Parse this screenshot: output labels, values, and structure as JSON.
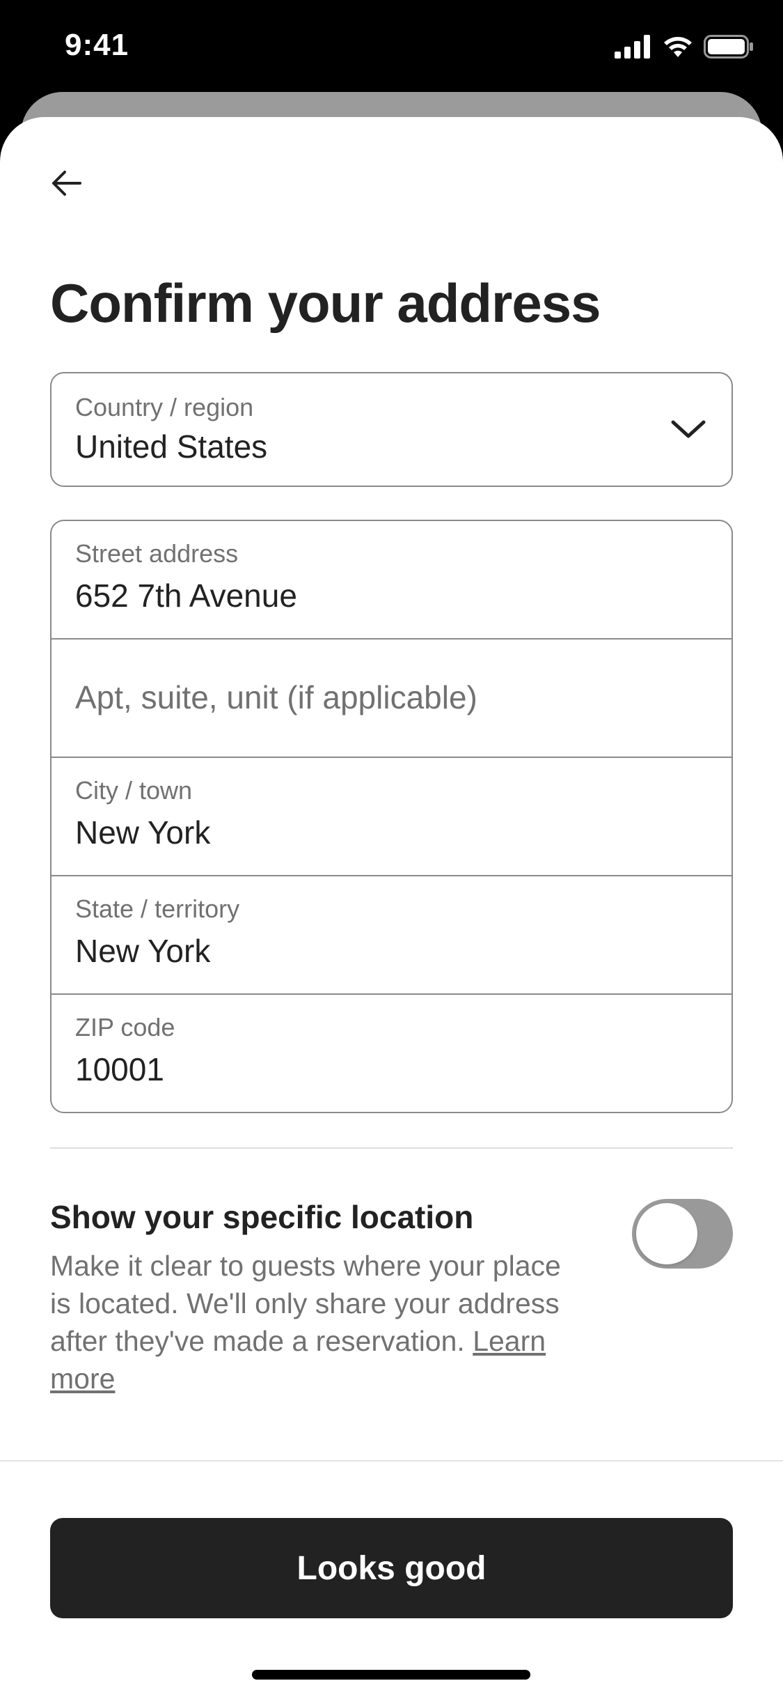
{
  "status_bar": {
    "time": "9:41",
    "icons": [
      "cellular-signal-icon",
      "wifi-icon",
      "battery-icon"
    ]
  },
  "header": {
    "back_icon": "arrow-left-icon",
    "title": "Confirm your address"
  },
  "country": {
    "label": "Country / region",
    "value": "United States",
    "icon": "chevron-down-icon"
  },
  "address": {
    "street": {
      "label": "Street address",
      "value": "652 7th Avenue"
    },
    "apt": {
      "placeholder": "Apt, suite, unit (if applicable)"
    },
    "city": {
      "label": "City / town",
      "value": "New York"
    },
    "state": {
      "label": "State / territory",
      "value": "New York"
    },
    "zip": {
      "label": "ZIP code",
      "value": "10001"
    }
  },
  "specific_location": {
    "title": "Show your specific location",
    "description": "Make it clear to guests where your place is located. We'll only share your address after they've made a reservation.",
    "learn_more": "Learn more",
    "toggle_on": false
  },
  "footer": {
    "button_label": "Looks good"
  },
  "colors": {
    "primary_text": "#222222",
    "secondary_text": "#717171",
    "border": "#8a8a8a",
    "button_bg": "#222222",
    "toggle_off": "#999999"
  }
}
